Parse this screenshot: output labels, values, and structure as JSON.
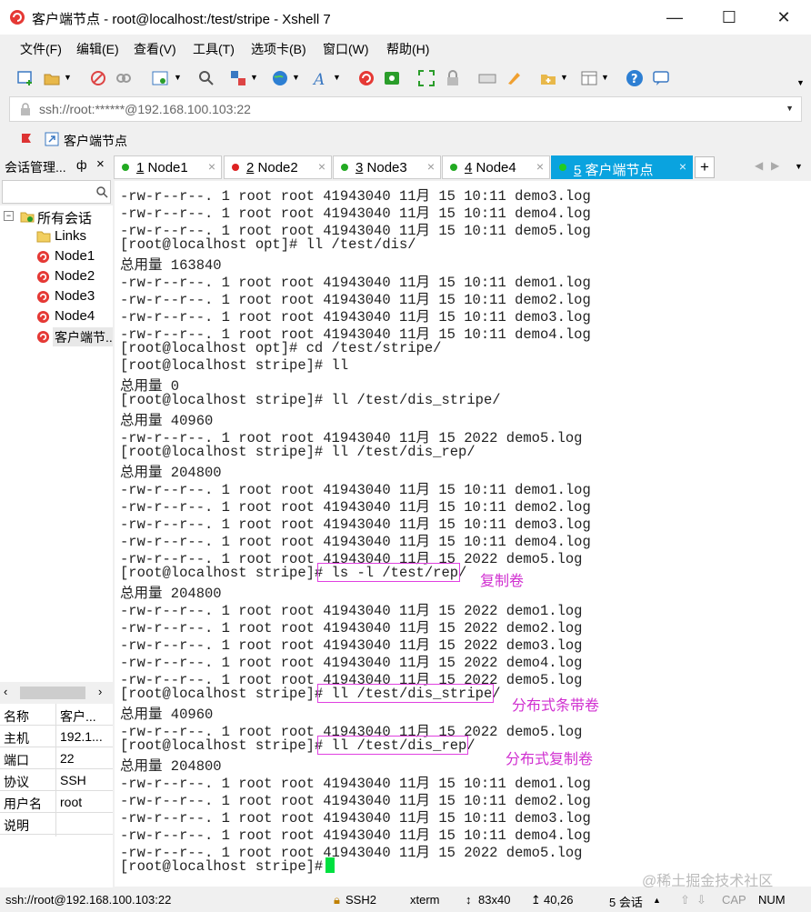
{
  "window": {
    "title": "客户端节点 - root@localhost:/test/stripe - Xshell 7",
    "minimize_glyph": "—",
    "maximize_glyph": "☐",
    "close_glyph": "✕"
  },
  "menu": [
    "文件(F)",
    "编辑(E)",
    "查看(V)",
    "工具(T)",
    "选项卡(B)",
    "窗口(W)",
    "帮助(H)"
  ],
  "address": {
    "value": "ssh://root:******@192.168.100.103:22"
  },
  "linkbar": {
    "item": "客户端节点"
  },
  "session_manager": {
    "title": "会话管理...",
    "pin": "ф",
    "close": "×",
    "tree": {
      "root": "所有会话",
      "items": [
        "Links",
        "Node1",
        "Node2",
        "Node3",
        "Node4",
        "客户端节..."
      ]
    }
  },
  "properties": [
    {
      "key": "名称",
      "value": "客户..."
    },
    {
      "key": "主机",
      "value": "192.1..."
    },
    {
      "key": "端口",
      "value": "22"
    },
    {
      "key": "协议",
      "value": "SSH"
    },
    {
      "key": "用户名",
      "value": "root"
    },
    {
      "key": "说明",
      "value": ""
    }
  ],
  "tabs": [
    {
      "num": "1",
      "label": "Node1",
      "color": "#22aa22"
    },
    {
      "num": "2",
      "label": "Node2",
      "color": "#dd2222"
    },
    {
      "num": "3",
      "label": "Node3",
      "color": "#22aa22"
    },
    {
      "num": "4",
      "label": "Node4",
      "color": "#22aa22"
    },
    {
      "num": "5",
      "label": "客户端节点",
      "color": "#22cc22",
      "active": true
    }
  ],
  "tab_close": "×",
  "terminal": {
    "lines": [
      "-rw-r--r--. 1 root root 41943040 11月 15 10:11 demo3.log",
      "-rw-r--r--. 1 root root 41943040 11月 15 10:11 demo4.log",
      "-rw-r--r--. 1 root root 41943040 11月 15 10:11 demo5.log",
      "[root@localhost opt]# ll /test/dis/",
      "总用量 163840",
      "-rw-r--r--. 1 root root 41943040 11月 15 10:11 demo1.log",
      "-rw-r--r--. 1 root root 41943040 11月 15 10:11 demo2.log",
      "-rw-r--r--. 1 root root 41943040 11月 15 10:11 demo3.log",
      "-rw-r--r--. 1 root root 41943040 11月 15 10:11 demo4.log",
      "[root@localhost opt]# cd /test/stripe/",
      "[root@localhost stripe]# ll",
      "总用量 0",
      "[root@localhost stripe]# ll /test/dis_stripe/",
      "总用量 40960",
      "-rw-r--r--. 1 root root 41943040 11月 15 2022 demo5.log",
      "[root@localhost stripe]# ll /test/dis_rep/",
      "总用量 204800",
      "-rw-r--r--. 1 root root 41943040 11月 15 10:11 demo1.log",
      "-rw-r--r--. 1 root root 41943040 11月 15 10:11 demo2.log",
      "-rw-r--r--. 1 root root 41943040 11月 15 10:11 demo3.log",
      "-rw-r--r--. 1 root root 41943040 11月 15 10:11 demo4.log",
      "-rw-r--r--. 1 root root 41943040 11月 15 2022 demo5.log",
      "[root@localhost stripe]# ls -l /test/rep/",
      "总用量 204800",
      "-rw-r--r--. 1 root root 41943040 11月 15 2022 demo1.log",
      "-rw-r--r--. 1 root root 41943040 11月 15 2022 demo2.log",
      "-rw-r--r--. 1 root root 41943040 11月 15 2022 demo3.log",
      "-rw-r--r--. 1 root root 41943040 11月 15 2022 demo4.log",
      "-rw-r--r--. 1 root root 41943040 11月 15 2022 demo5.log",
      "[root@localhost stripe]# ll /test/dis_stripe/",
      "总用量 40960",
      "-rw-r--r--. 1 root root 41943040 11月 15 2022 demo5.log",
      "[root@localhost stripe]# ll /test/dis_rep/",
      "总用量 204800",
      "-rw-r--r--. 1 root root 41943040 11月 15 10:11 demo1.log",
      "-rw-r--r--. 1 root root 41943040 11月 15 10:11 demo2.log",
      "-rw-r--r--. 1 root root 41943040 11月 15 10:11 demo3.log",
      "-rw-r--r--. 1 root root 41943040 11月 15 10:11 demo4.log",
      "-rw-r--r--. 1 root root 41943040 11月 15 2022 demo5.log",
      "[root@localhost stripe]# "
    ],
    "annotations": [
      "复制卷",
      "分布式条带卷",
      "分布式复制卷"
    ],
    "watermark": "@稀土掘金技术社区"
  },
  "status": {
    "connection": "ssh://root@192.168.100.103:22",
    "protocol": "SSH2",
    "term": "xterm",
    "size": "83x40",
    "cursor": "40,26",
    "sessions": "5 会话",
    "cap": "CAP",
    "num": "NUM"
  }
}
